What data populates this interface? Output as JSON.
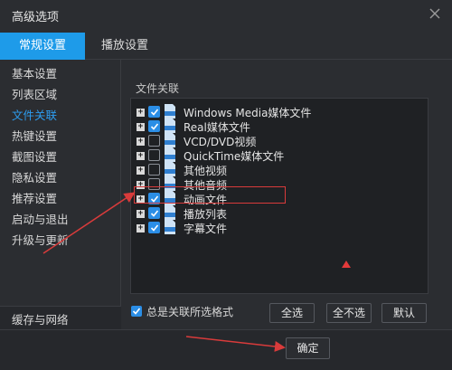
{
  "window": {
    "title": "高级选项"
  },
  "tabs": [
    {
      "label": "常规设置",
      "active": true
    },
    {
      "label": "播放设置",
      "active": false
    }
  ],
  "sidebar": {
    "items": [
      {
        "label": "基本设置"
      },
      {
        "label": "列表区域"
      },
      {
        "label": "文件关联",
        "active": true
      },
      {
        "label": "热键设置"
      },
      {
        "label": "截图设置"
      },
      {
        "label": "隐私设置"
      },
      {
        "label": "推荐设置"
      },
      {
        "label": "启动与退出"
      },
      {
        "label": "升级与更新"
      }
    ],
    "bottom_item": "缓存与网络"
  },
  "file_association": {
    "section_label": "文件关联",
    "rows": [
      {
        "label": "Windows Media媒体文件",
        "checked": true,
        "icon": "file-icon-asf"
      },
      {
        "label": "Real媒体文件",
        "checked": true,
        "icon": "file-icon-rm"
      },
      {
        "label": "VCD/DVD视频",
        "checked": false,
        "icon": "file-icon-dat"
      },
      {
        "label": "QuickTime媒体文件",
        "checked": false,
        "icon": "file-icon-qt"
      },
      {
        "label": "其他视频",
        "checked": false,
        "icon": "file-icon-video"
      },
      {
        "label": "其他音频",
        "checked": false,
        "icon": "file-icon-audio"
      },
      {
        "label": "动画文件",
        "checked": true,
        "icon": "file-icon-flv",
        "highlighted": true
      },
      {
        "label": "播放列表",
        "checked": true,
        "icon": "file-icon-list"
      },
      {
        "label": "字幕文件",
        "checked": true,
        "icon": "file-icon-srt"
      }
    ],
    "always_associate_label": "总是关联所选格式",
    "always_associate_checked": true
  },
  "buttons": {
    "select_all": "全选",
    "select_none": "全不选",
    "default": "默认",
    "ok": "确定"
  },
  "colors": {
    "accent": "#1e9be9",
    "background": "#2b2d31",
    "annotation_red": "#d93b3b"
  }
}
